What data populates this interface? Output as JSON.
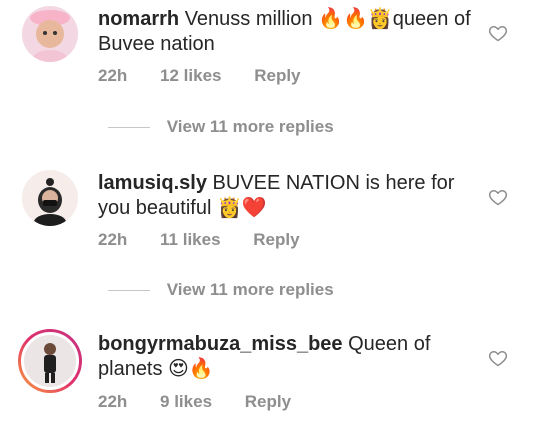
{
  "comments": [
    {
      "username": "nomarrh",
      "text": "Venuss million 🔥🔥👸queen of Buvee nation",
      "time": "22h",
      "likes": "12 likes",
      "reply": "Reply",
      "more_replies": "View 11 more replies"
    },
    {
      "username": "lamusiq.sly",
      "text": "BUVEE NATION is here for you beautiful 👸❤️",
      "time": "22h",
      "likes": "11 likes",
      "reply": "Reply",
      "more_replies": "View 11 more replies"
    },
    {
      "username": "bongyrmabuza_miss_bee",
      "text": "Queen of planets 😍🔥",
      "time": "22h",
      "likes": "9 likes",
      "reply": "Reply"
    }
  ],
  "icons": {
    "like": "heart-outline-icon"
  },
  "colors": {
    "text": "#262626",
    "meta": "#8e8e8e",
    "ring_start": "#f9a13a",
    "ring_end": "#c13584"
  }
}
